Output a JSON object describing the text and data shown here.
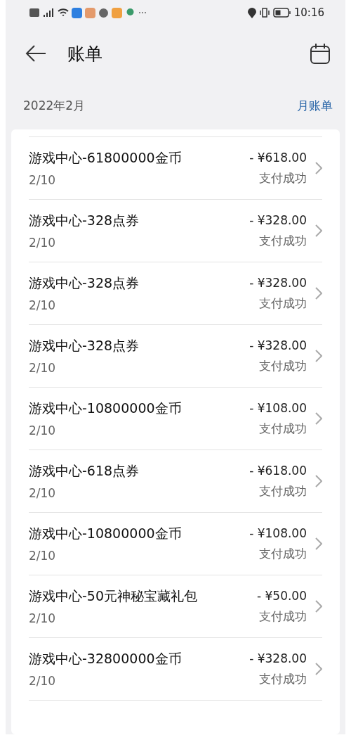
{
  "status_bar": {
    "time": "10:16"
  },
  "header": {
    "title": "账单"
  },
  "period": {
    "label": "2022年2月",
    "link": "月账单"
  },
  "bills": [
    {
      "title": "游戏中心-61800000金币",
      "date": "2/10",
      "amount": "- ¥618.00",
      "status": "支付成功"
    },
    {
      "title": "游戏中心-328点券",
      "date": "2/10",
      "amount": "- ¥328.00",
      "status": "支付成功"
    },
    {
      "title": "游戏中心-328点券",
      "date": "2/10",
      "amount": "- ¥328.00",
      "status": "支付成功"
    },
    {
      "title": "游戏中心-328点券",
      "date": "2/10",
      "amount": "- ¥328.00",
      "status": "支付成功"
    },
    {
      "title": "游戏中心-10800000金币",
      "date": "2/10",
      "amount": "- ¥108.00",
      "status": "支付成功"
    },
    {
      "title": "游戏中心-618点券",
      "date": "2/10",
      "amount": "- ¥618.00",
      "status": "支付成功"
    },
    {
      "title": "游戏中心-10800000金币",
      "date": "2/10",
      "amount": "- ¥108.00",
      "status": "支付成功"
    },
    {
      "title": "游戏中心-50元神秘宝藏礼包",
      "date": "2/10",
      "amount": "- ¥50.00",
      "status": "支付成功"
    },
    {
      "title": "游戏中心-32800000金币",
      "date": "2/10",
      "amount": "- ¥328.00",
      "status": "支付成功"
    }
  ]
}
